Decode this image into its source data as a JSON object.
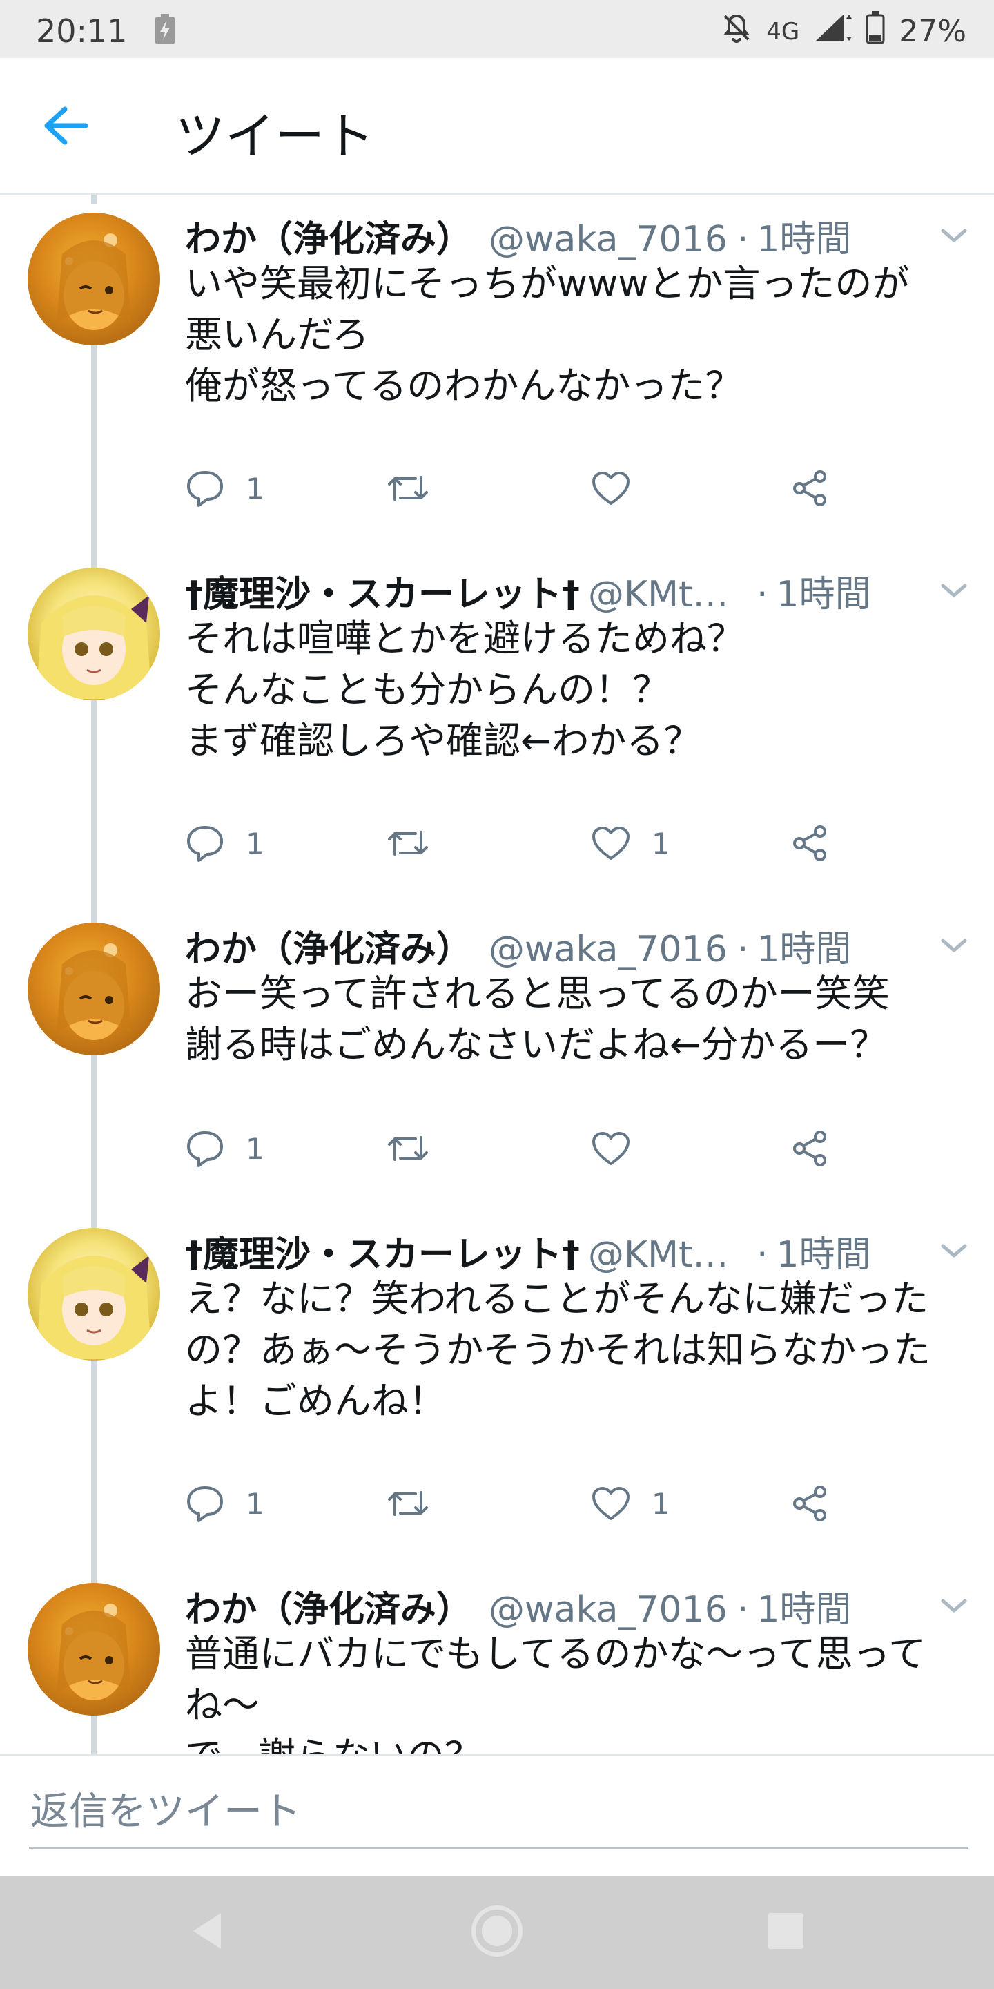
{
  "status_bar": {
    "time": "20:11",
    "network": "4G",
    "battery": "27%"
  },
  "header": {
    "title": "ツイート"
  },
  "colors": {
    "accent": "#1da1f2",
    "secondary_text": "#657786",
    "thread_line": "#cfd9de"
  },
  "tweets": [
    {
      "name": "わか（浄化済み）",
      "handle": "@waka_7016",
      "dot": "·",
      "time": "1時間",
      "text": "いや笑最初にそっちがwwwとか言ったのが\n悪いんだろ\n俺が怒ってるのわかんなかった？",
      "reply_count": "1",
      "retweet_count": "",
      "like_count": ""
    },
    {
      "name": "†魔理沙・スカーレット†",
      "handle": "@KMto...",
      "dot": "·",
      "time": "1時間",
      "text": "それは喧嘩とかを避けるためね？\nそんなことも分からんの！？\nまず確認しろや確認←わかる？",
      "reply_count": "1",
      "retweet_count": "",
      "like_count": "1"
    },
    {
      "name": "わか（浄化済み）",
      "handle": "@waka_7016",
      "dot": "·",
      "time": "1時間",
      "text": "おー笑って許されると思ってるのかー笑笑\n謝る時はごめんなさいだよね←分かるー？",
      "reply_count": "1",
      "retweet_count": "",
      "like_count": ""
    },
    {
      "name": "†魔理沙・スカーレット†",
      "handle": "@KMto...",
      "dot": "·",
      "time": "1時間",
      "text": "え？なに？笑われることがそんなに嫌だった\nの？あぁ～そうかそうかそれは知らなかった\nよ！ごめんね！",
      "reply_count": "1",
      "retweet_count": "",
      "like_count": "1"
    },
    {
      "name": "わか（浄化済み）",
      "handle": "@waka_7016",
      "dot": "·",
      "time": "1時間",
      "text": "普通にバカにでもしてるのかな～って思って\nね～\nで、謝らないの？",
      "reply_count": "",
      "retweet_count": "",
      "like_count": ""
    }
  ],
  "reply_bar": {
    "placeholder": "返信をツイート"
  }
}
